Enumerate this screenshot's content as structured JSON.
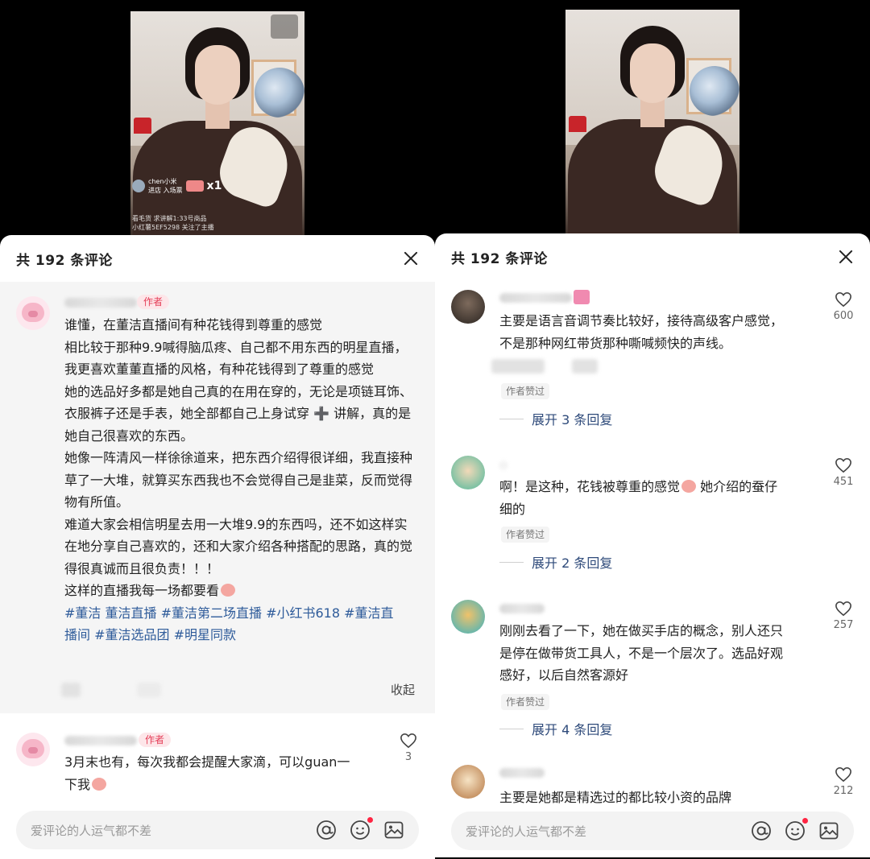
{
  "left": {
    "header": {
      "title": "共 192 条评论"
    },
    "pinned_comment": {
      "author_tag": "作者",
      "paragraphs": [
        "谁懂，在董洁直播间有种花钱得到尊重的感觉",
        "相比较于那种9.9喊得脑瓜疼、自己都不用东西的明星直播，我更喜欢董董直播的风格，有种花钱得到了尊重的感觉",
        "她的选品好多都是她自己真的在用在穿的，无论是项链耳饰、衣服裤子还是手表，她全部都自己上身试穿 ➕ 讲解，真的是她自己很喜欢的东西。",
        "她像一阵清风一样徐徐道来，把东西介绍得很详细，我直接种草了一大堆，就算买东西我也不会觉得自己是韭菜，反而觉得物有所值。",
        "难道大家会相信明星去用一大堆9.9的东西吗，还不如这样实在地分享自己喜欢的，还和大家介绍各种搭配的思路，真的觉得很真诚而且很负责！！！",
        "这样的直播我每一场都要看"
      ],
      "hashtags_line1": "#董洁 董洁直播 #董洁第二场直播 #小红书618 #董洁直",
      "hashtags_line2": "播间 #董洁选品团 #明星同款",
      "collapse_label": "收起"
    },
    "reply_comment": {
      "author_tag": "作者",
      "line1": "3月末也有，每次我都会提醒大家滴，可以guan一",
      "line2": "下我",
      "likes": "3"
    },
    "input": {
      "placeholder": "爱评论的人运气都不差"
    }
  },
  "right": {
    "header": {
      "title": "共 192 条评论"
    },
    "comments": [
      {
        "line1": "主要是语言音调节奏比较好，接待高级客户感觉，",
        "line2": "不是那种网红带货那种嘶喊频快的声线。",
        "likes": "600",
        "liked_by": "作者赞过",
        "expand": "展开 3 条回复"
      },
      {
        "line1": "啊！是这种，花钱被尊重的感觉",
        "line1b": "她介绍的蚕仔",
        "line2": "细的",
        "likes": "451",
        "liked_by": "作者赞过",
        "expand": "展开 2 条回复"
      },
      {
        "line1": "刚刚去看了一下，她在做买手店的概念，别人还只",
        "line2": "是停在做带货工具人，不是一个层次了。选品好观",
        "line3": "感好，以后自然客源好",
        "likes": "257",
        "liked_by": "作者赞过",
        "expand": "展开 4 条回复"
      },
      {
        "line1": "主要是她都是精选过的都比较小资的品牌",
        "likes": "212"
      }
    ],
    "input": {
      "placeholder": "爱评论的人运气都不差"
    }
  },
  "video_left": {
    "hud_user": "chen小米",
    "hud_sub": "进店 入场票",
    "hud_count": "x1",
    "ticker1": "看毛货 求讲解1:33号商品",
    "ticker2": "小红薯5EF5298 关注了主播"
  },
  "icons": [
    "close-icon",
    "heart-icon",
    "at-icon",
    "emoji-icon",
    "image-icon"
  ],
  "colors": {
    "author_tag_bg": "#fde6e9",
    "author_tag_text": "#e43d57",
    "hashtag": "#2e5b9a",
    "expand": "#2e4a7a",
    "notify_dot": "#ff2442"
  }
}
